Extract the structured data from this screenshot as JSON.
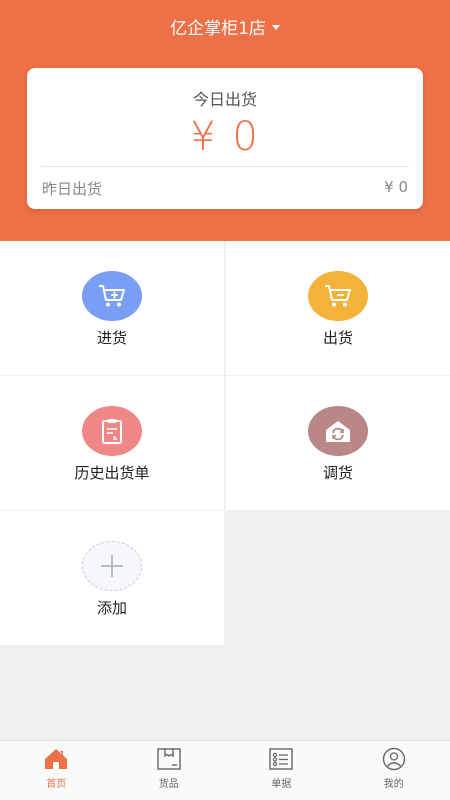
{
  "header": {
    "store_name": "亿企掌柜1店",
    "color": "#ee7046"
  },
  "summary": {
    "today_label": "今日出货",
    "today_amount": "¥ 0",
    "yesterday_label": "昨日出货",
    "yesterday_amount": "¥ 0"
  },
  "menu": {
    "stock_in": {
      "label": "进货",
      "icon": "cart-plus-icon",
      "color": "#7b9ef5"
    },
    "stock_out": {
      "label": "出货",
      "icon": "cart-minus-icon",
      "color": "#f3b33b"
    },
    "history": {
      "label": "历史出货单",
      "icon": "clipboard-icon",
      "color": "#ef8787"
    },
    "transfer": {
      "label": "调货",
      "icon": "house-refresh-icon",
      "color": "#b88786"
    },
    "add": {
      "label": "添加",
      "icon": "plus-icon"
    }
  },
  "tabbar": {
    "home": {
      "label": "首页",
      "icon": "home-icon",
      "active": true
    },
    "goods": {
      "label": "货品",
      "icon": "box-icon"
    },
    "orders": {
      "label": "单据",
      "icon": "list-icon"
    },
    "mine": {
      "label": "我的",
      "icon": "user-icon"
    }
  }
}
